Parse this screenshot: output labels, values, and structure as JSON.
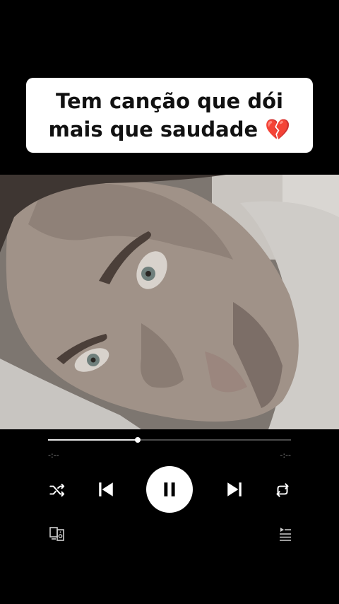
{
  "caption": {
    "line1": "Tem canção que dói",
    "line2": "mais que saudade 💔"
  },
  "player": {
    "progress": 0.37,
    "time_elapsed": "-:--",
    "time_remaining": "-:--",
    "state": "playing"
  },
  "icons": {
    "shuffle": "shuffle-icon",
    "previous": "skip-previous-icon",
    "play_pause": "pause-icon",
    "next": "skip-next-icon",
    "repeat": "repeat-icon",
    "devices": "devices-icon",
    "queue": "queue-icon"
  },
  "colors": {
    "background": "#000000",
    "caption_bg": "#ffffff",
    "caption_text": "#111111",
    "progress_fill": "#e8e8e8",
    "progress_track": "#4a4a4a"
  }
}
